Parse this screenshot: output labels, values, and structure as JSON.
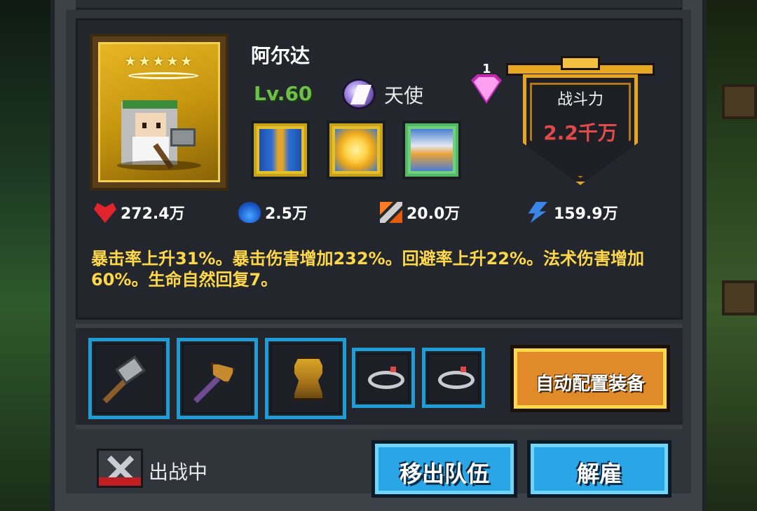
{
  "hero": {
    "name": "阿尔达",
    "stars": "★★★★★",
    "level": "Lv.60",
    "class_name": "天使",
    "class_icon": "angel-wing-icon"
  },
  "skills": [
    {
      "name": "skill-holy-sword-icon"
    },
    {
      "name": "skill-sun-burst-icon"
    },
    {
      "name": "skill-angel-wings-icon"
    }
  ],
  "skill_points": {
    "count": "1",
    "icon": "gem-icon",
    "color": "#ff9ff2"
  },
  "power": {
    "label": "战斗力",
    "value": "2.2千万",
    "value_color": "#e04a4a"
  },
  "stats": {
    "hp": "272.4万",
    "mp": "2.5万",
    "attack": "20.0万",
    "speed": "159.9万"
  },
  "description": "暴击率上升31%。暴击伤害增加232%。回避率上升22%。法术伤害增加60%。生命自然回复7。",
  "equipment": [
    {
      "slot": "weapon-1",
      "icon": "hammer-icon"
    },
    {
      "slot": "weapon-2",
      "icon": "axe-icon"
    },
    {
      "slot": "armor",
      "icon": "armor-icon"
    },
    {
      "slot": "ring-1",
      "icon": "ring-icon"
    },
    {
      "slot": "ring-2",
      "icon": "ring-icon"
    }
  ],
  "buttons": {
    "auto_equip": "自动配置装备",
    "remove_from_team": "移出队伍",
    "dismiss": "解雇"
  },
  "status": {
    "deploy": "出战中"
  },
  "colors": {
    "accent_gold": "#e6a620",
    "slot_border": "#1f9bd6",
    "level_green": "#6cc04a",
    "desc_yellow": "#ffd84a"
  }
}
